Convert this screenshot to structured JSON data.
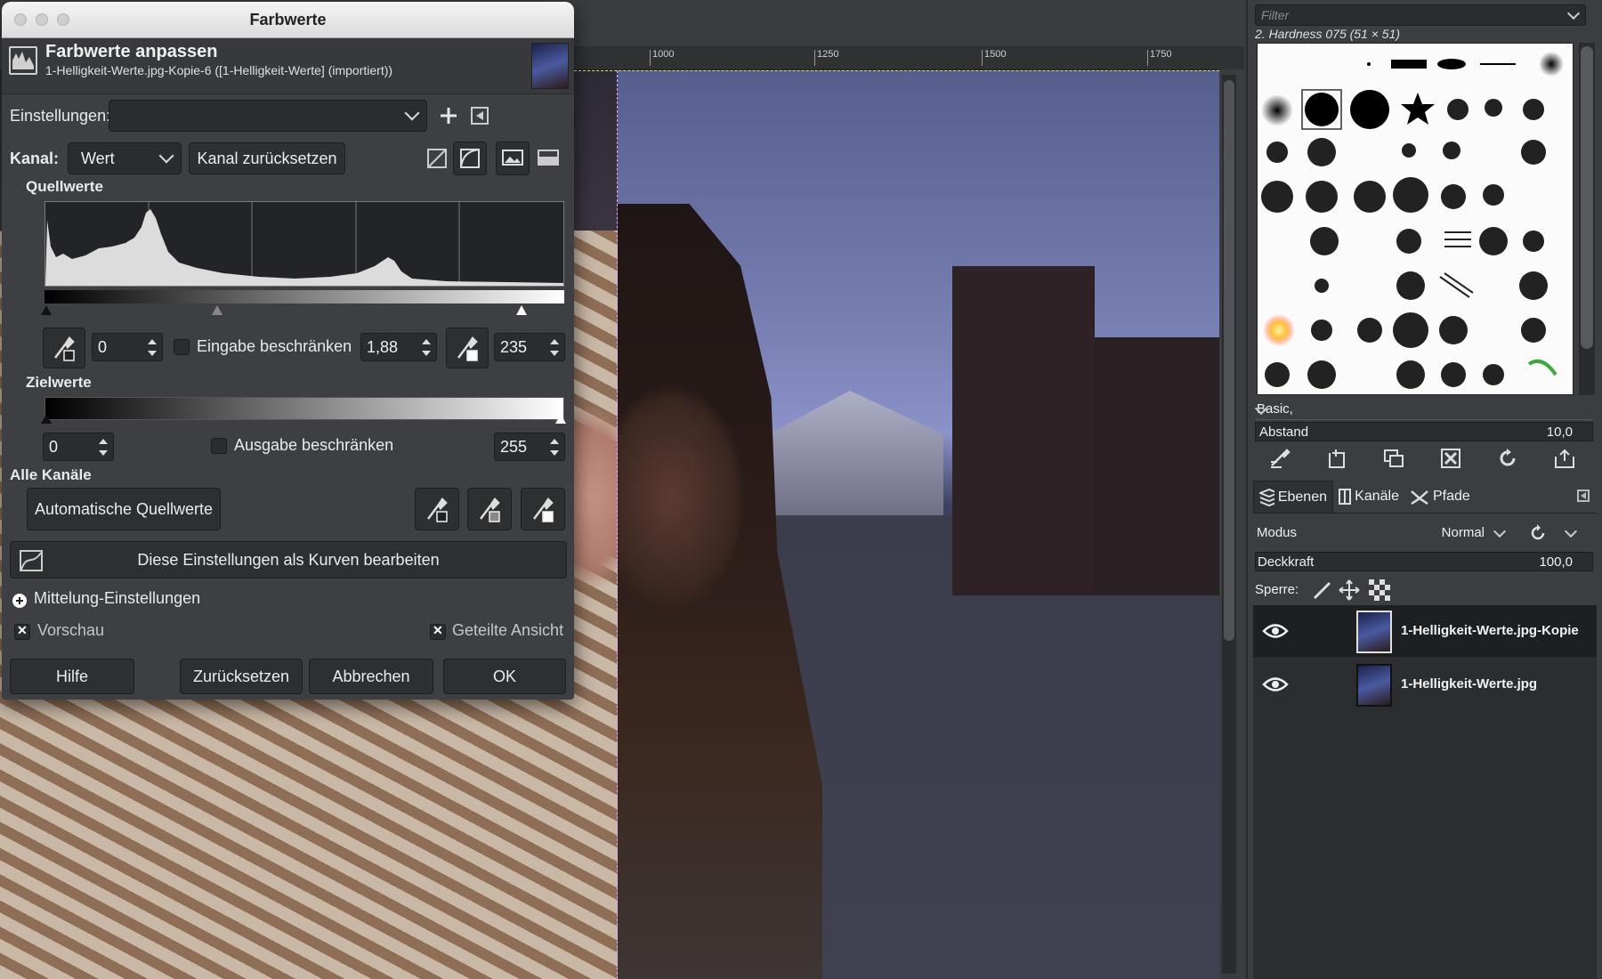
{
  "ruler": {
    "labels": [
      "1000",
      "1250",
      "1500",
      "1750"
    ]
  },
  "dialog": {
    "window_title": "Farbwerte",
    "header_title": "Farbwerte anpassen",
    "header_subtitle": "1-Helligkeit-Werte.jpg-Kopie-6 ([1-Helligkeit-Werte] (importiert))",
    "settings_label": "Einstellungen:",
    "settings_value": "",
    "channel_label": "Kanal:",
    "channel_value": "Wert",
    "reset_channel": "Kanal zurücksetzen",
    "input_section": "Quellwerte",
    "input_low": "0",
    "clamp_input": "Eingabe beschränken",
    "gamma": "1,88",
    "input_high": "235",
    "output_section": "Zielwerte",
    "output_low": "0",
    "clamp_output": "Ausgabe beschränken",
    "output_high": "255",
    "all_channels": "Alle Kanäle",
    "auto_input": "Automatische Quellwerte",
    "edit_as_curves": "Diese Einstellungen als Kurven bearbeiten",
    "blending_options": "Mittelung-Einstellungen",
    "preview": "Vorschau",
    "preview_checked": true,
    "split_view": "Geteilte Ansicht",
    "split_view_checked": true,
    "help": "Hilfe",
    "reset": "Zurücksetzen",
    "cancel": "Abbrechen",
    "ok": "OK",
    "input_low_fraction": 0.0,
    "input_high_fraction": 0.92,
    "clamp_input_checked": false,
    "clamp_output_checked": false
  },
  "brushes": {
    "filter_placeholder": "Filter",
    "selected_brush": "2. Hardness 075 (51 × 51)",
    "preset": "Basic,",
    "spacing_label": "Abstand",
    "spacing_value": "10,0"
  },
  "layers_panel": {
    "tabs": [
      "Ebenen",
      "Kanäle",
      "Pfade"
    ],
    "mode_label": "Modus",
    "mode_value": "Normal",
    "opacity_label": "Deckkraft",
    "opacity_value": "100,0",
    "lock_label": "Sperre:",
    "layers": [
      {
        "name": "1-Helligkeit-Werte.jpg-Kopie",
        "visible": true,
        "selected": true
      },
      {
        "name": "1-Helligkeit-Werte.jpg",
        "visible": true,
        "selected": false
      }
    ]
  },
  "colors": {
    "accent_split": "#e7a8ff",
    "panel_bg": "#3b3d40"
  }
}
